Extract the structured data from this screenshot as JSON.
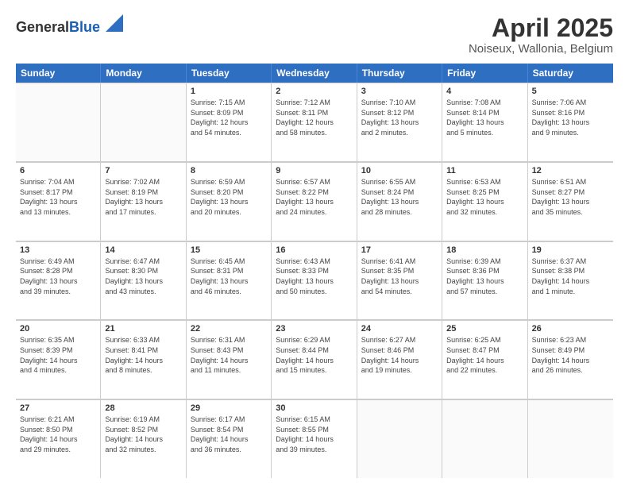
{
  "logo": {
    "general": "General",
    "blue": "Blue"
  },
  "header": {
    "title": "April 2025",
    "subtitle": "Noiseux, Wallonia, Belgium"
  },
  "calendar": {
    "days": [
      "Sunday",
      "Monday",
      "Tuesday",
      "Wednesday",
      "Thursday",
      "Friday",
      "Saturday"
    ],
    "weeks": [
      [
        {
          "day": "",
          "info": ""
        },
        {
          "day": "",
          "info": ""
        },
        {
          "day": "1",
          "info": "Sunrise: 7:15 AM\nSunset: 8:09 PM\nDaylight: 12 hours\nand 54 minutes."
        },
        {
          "day": "2",
          "info": "Sunrise: 7:12 AM\nSunset: 8:11 PM\nDaylight: 12 hours\nand 58 minutes."
        },
        {
          "day": "3",
          "info": "Sunrise: 7:10 AM\nSunset: 8:12 PM\nDaylight: 13 hours\nand 2 minutes."
        },
        {
          "day": "4",
          "info": "Sunrise: 7:08 AM\nSunset: 8:14 PM\nDaylight: 13 hours\nand 5 minutes."
        },
        {
          "day": "5",
          "info": "Sunrise: 7:06 AM\nSunset: 8:16 PM\nDaylight: 13 hours\nand 9 minutes."
        }
      ],
      [
        {
          "day": "6",
          "info": "Sunrise: 7:04 AM\nSunset: 8:17 PM\nDaylight: 13 hours\nand 13 minutes."
        },
        {
          "day": "7",
          "info": "Sunrise: 7:02 AM\nSunset: 8:19 PM\nDaylight: 13 hours\nand 17 minutes."
        },
        {
          "day": "8",
          "info": "Sunrise: 6:59 AM\nSunset: 8:20 PM\nDaylight: 13 hours\nand 20 minutes."
        },
        {
          "day": "9",
          "info": "Sunrise: 6:57 AM\nSunset: 8:22 PM\nDaylight: 13 hours\nand 24 minutes."
        },
        {
          "day": "10",
          "info": "Sunrise: 6:55 AM\nSunset: 8:24 PM\nDaylight: 13 hours\nand 28 minutes."
        },
        {
          "day": "11",
          "info": "Sunrise: 6:53 AM\nSunset: 8:25 PM\nDaylight: 13 hours\nand 32 minutes."
        },
        {
          "day": "12",
          "info": "Sunrise: 6:51 AM\nSunset: 8:27 PM\nDaylight: 13 hours\nand 35 minutes."
        }
      ],
      [
        {
          "day": "13",
          "info": "Sunrise: 6:49 AM\nSunset: 8:28 PM\nDaylight: 13 hours\nand 39 minutes."
        },
        {
          "day": "14",
          "info": "Sunrise: 6:47 AM\nSunset: 8:30 PM\nDaylight: 13 hours\nand 43 minutes."
        },
        {
          "day": "15",
          "info": "Sunrise: 6:45 AM\nSunset: 8:31 PM\nDaylight: 13 hours\nand 46 minutes."
        },
        {
          "day": "16",
          "info": "Sunrise: 6:43 AM\nSunset: 8:33 PM\nDaylight: 13 hours\nand 50 minutes."
        },
        {
          "day": "17",
          "info": "Sunrise: 6:41 AM\nSunset: 8:35 PM\nDaylight: 13 hours\nand 54 minutes."
        },
        {
          "day": "18",
          "info": "Sunrise: 6:39 AM\nSunset: 8:36 PM\nDaylight: 13 hours\nand 57 minutes."
        },
        {
          "day": "19",
          "info": "Sunrise: 6:37 AM\nSunset: 8:38 PM\nDaylight: 14 hours\nand 1 minute."
        }
      ],
      [
        {
          "day": "20",
          "info": "Sunrise: 6:35 AM\nSunset: 8:39 PM\nDaylight: 14 hours\nand 4 minutes."
        },
        {
          "day": "21",
          "info": "Sunrise: 6:33 AM\nSunset: 8:41 PM\nDaylight: 14 hours\nand 8 minutes."
        },
        {
          "day": "22",
          "info": "Sunrise: 6:31 AM\nSunset: 8:43 PM\nDaylight: 14 hours\nand 11 minutes."
        },
        {
          "day": "23",
          "info": "Sunrise: 6:29 AM\nSunset: 8:44 PM\nDaylight: 14 hours\nand 15 minutes."
        },
        {
          "day": "24",
          "info": "Sunrise: 6:27 AM\nSunset: 8:46 PM\nDaylight: 14 hours\nand 19 minutes."
        },
        {
          "day": "25",
          "info": "Sunrise: 6:25 AM\nSunset: 8:47 PM\nDaylight: 14 hours\nand 22 minutes."
        },
        {
          "day": "26",
          "info": "Sunrise: 6:23 AM\nSunset: 8:49 PM\nDaylight: 14 hours\nand 26 minutes."
        }
      ],
      [
        {
          "day": "27",
          "info": "Sunrise: 6:21 AM\nSunset: 8:50 PM\nDaylight: 14 hours\nand 29 minutes."
        },
        {
          "day": "28",
          "info": "Sunrise: 6:19 AM\nSunset: 8:52 PM\nDaylight: 14 hours\nand 32 minutes."
        },
        {
          "day": "29",
          "info": "Sunrise: 6:17 AM\nSunset: 8:54 PM\nDaylight: 14 hours\nand 36 minutes."
        },
        {
          "day": "30",
          "info": "Sunrise: 6:15 AM\nSunset: 8:55 PM\nDaylight: 14 hours\nand 39 minutes."
        },
        {
          "day": "",
          "info": ""
        },
        {
          "day": "",
          "info": ""
        },
        {
          "day": "",
          "info": ""
        }
      ]
    ]
  }
}
